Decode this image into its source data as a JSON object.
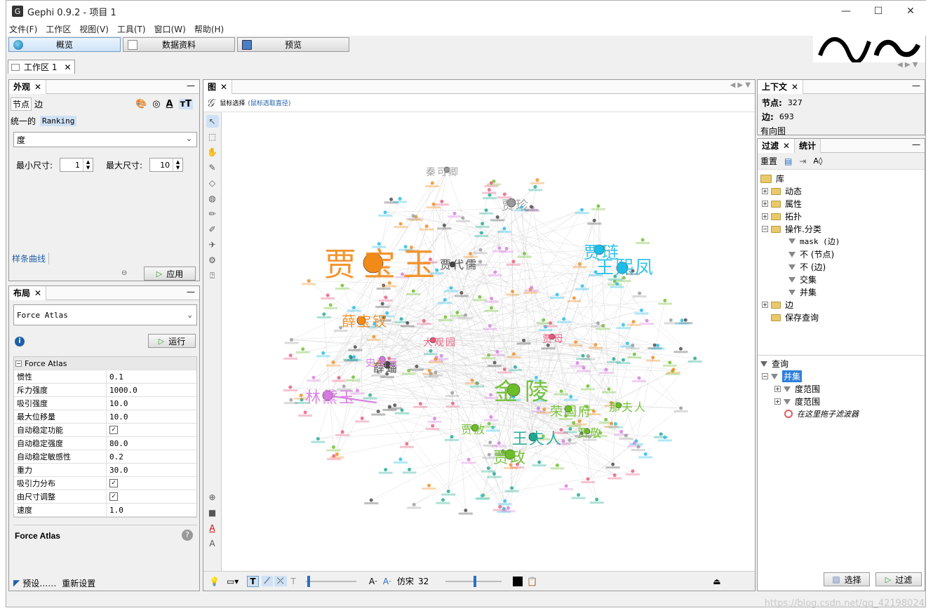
{
  "window": {
    "title": "Gephi 0.9.2 - 项目 1",
    "icon": "gephi-logo-icon"
  },
  "menu": [
    "文件(F)",
    "工作区",
    "视图(V)",
    "工具(T)",
    "窗口(W)",
    "帮助(H)"
  ],
  "modes": [
    {
      "label": "概览",
      "icon": "globe-icon"
    },
    {
      "label": "数据资料",
      "icon": "table-icon"
    },
    {
      "label": "预览",
      "icon": "monitor-icon"
    }
  ],
  "workspace_tab": "工作区 1",
  "appearance": {
    "tab": "外观",
    "subtabs": [
      "节点",
      "边"
    ],
    "modes": [
      "统一的",
      "Ranking"
    ],
    "attribute": "度",
    "min_size_label": "最小尺寸:",
    "min_size": "1",
    "max_size_label": "最大尺寸:",
    "max_size": "10",
    "spline": "样条曲线",
    "apply": "应用"
  },
  "layout": {
    "tab": "布局",
    "algorithm": "Force Atlas",
    "run": "运行",
    "section": "Force Atlas",
    "properties": [
      {
        "k": "惯性",
        "v": "0.1"
      },
      {
        "k": "斥力强度",
        "v": "1000.0"
      },
      {
        "k": "吸引强度",
        "v": "10.0"
      },
      {
        "k": "最大位移量",
        "v": "10.0"
      },
      {
        "k": "自动稳定功能",
        "v": "✓"
      },
      {
        "k": "自动稳定强度",
        "v": "80.0"
      },
      {
        "k": "自动稳定敏感性",
        "v": "0.2"
      },
      {
        "k": "重力",
        "v": "30.0"
      },
      {
        "k": "吸引力分布",
        "v": "✓"
      },
      {
        "k": "由尺寸调整",
        "v": "✓"
      },
      {
        "k": "速度",
        "v": "1.0"
      }
    ],
    "desc_title": "Force Atlas",
    "presets": "预设……",
    "reset": "重新设置"
  },
  "graph": {
    "tab": "图",
    "hint_main": "鼠标选择",
    "hint_sub": "(鼠标选取直径)",
    "font_name": "仿宋",
    "font_size": "32",
    "nodes": [
      {
        "label": "贾宝玉",
        "color": "#f28a1a",
        "r": 14
      },
      {
        "label": "王熙凤",
        "color": "#1ebde8",
        "r": 8
      },
      {
        "label": "贾琏",
        "color": "#1ebde8",
        "r": 7
      },
      {
        "label": "林黛玉",
        "color": "#d67ae0",
        "r": 7
      },
      {
        "label": "金陵",
        "color": "#6cbd2a",
        "r": 9
      },
      {
        "label": "薛宝钗",
        "color": "#f28a1a",
        "r": 6
      },
      {
        "label": "王夫人",
        "color": "#1aa88e",
        "r": 6
      },
      {
        "label": "贾政",
        "color": "#6cbd2a",
        "r": 7
      },
      {
        "label": "荣国府",
        "color": "#6cbd2a",
        "r": 5
      },
      {
        "label": "贾代儒",
        "color": "#444444",
        "r": 4
      },
      {
        "label": "贾珍",
        "color": "#999999",
        "r": 6
      },
      {
        "label": "秦可卿",
        "color": "#999999",
        "r": 4
      },
      {
        "label": "薛蟠",
        "color": "#444444",
        "r": 5
      },
      {
        "label": "史湘云",
        "color": "#d67ae0",
        "r": 4
      },
      {
        "label": "那夫人",
        "color": "#6cbd2a",
        "r": 4
      },
      {
        "label": "贾敬",
        "color": "#6cbd2a",
        "r": 4
      },
      {
        "label": "贾赦",
        "color": "#6cbd2a",
        "r": 5
      },
      {
        "label": "大观园",
        "color": "#e8567a",
        "r": 4
      },
      {
        "label": "贾母",
        "color": "#e8567a",
        "r": 4
      }
    ]
  },
  "context": {
    "tab": "上下文",
    "nodes_label": "节点:",
    "nodes": "327",
    "edges_label": "边:",
    "edges": "693",
    "type": "有向图"
  },
  "filters": {
    "tabs": [
      "过滤",
      "统计"
    ],
    "reset": "重置",
    "library": "库",
    "items": [
      {
        "label": "动态",
        "kind": "folder",
        "level": 1
      },
      {
        "label": "属性",
        "kind": "folder",
        "level": 1
      },
      {
        "label": "拓扑",
        "kind": "folder",
        "level": 1
      },
      {
        "label": "操作.分类",
        "kind": "folder-open",
        "level": 1
      },
      {
        "label": "mask (边)",
        "kind": "filter",
        "level": 2
      },
      {
        "label": "不 (节点)",
        "kind": "filter",
        "level": 2
      },
      {
        "label": "不 (边)",
        "kind": "filter",
        "level": 2
      },
      {
        "label": "交集",
        "kind": "filter",
        "level": 2
      },
      {
        "label": "并集",
        "kind": "filter",
        "level": 2
      },
      {
        "label": "边",
        "kind": "folder",
        "level": 1
      },
      {
        "label": "保存查询",
        "kind": "folder-leaf",
        "level": 1
      }
    ],
    "query_title": "查询",
    "query": [
      {
        "label": "并集",
        "level": 1,
        "selected": true
      },
      {
        "label": "度范围",
        "level": 2
      },
      {
        "label": "度范围",
        "level": 2
      },
      {
        "label": "在这里拖子滤波器",
        "level": 2,
        "italic": true
      }
    ],
    "select": "选择",
    "filter": "过滤"
  },
  "watermark": "https://blog.csdn.net/qq_42198024"
}
